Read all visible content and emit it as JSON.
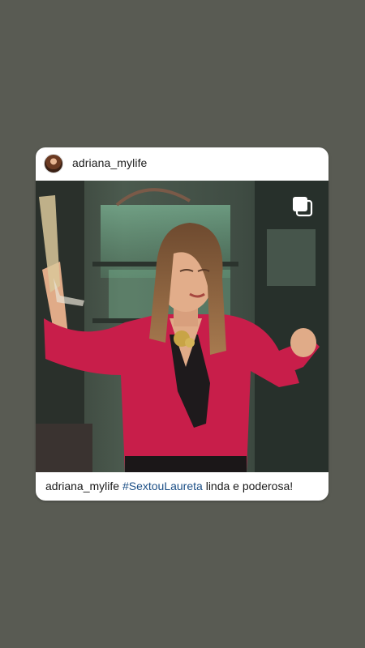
{
  "post": {
    "username": "adriana_mylife",
    "avatar_icon": "profile-avatar",
    "carousel_icon": "multiple-photos-icon",
    "caption": {
      "username": "adriana_mylife",
      "hashtag": "#SextouLaureta",
      "text": "linda e poderosa!"
    }
  },
  "colors": {
    "background": "#595b53",
    "card": "#ffffff",
    "hashtag": "#1c4f86",
    "blouse": "#c81e4a"
  }
}
